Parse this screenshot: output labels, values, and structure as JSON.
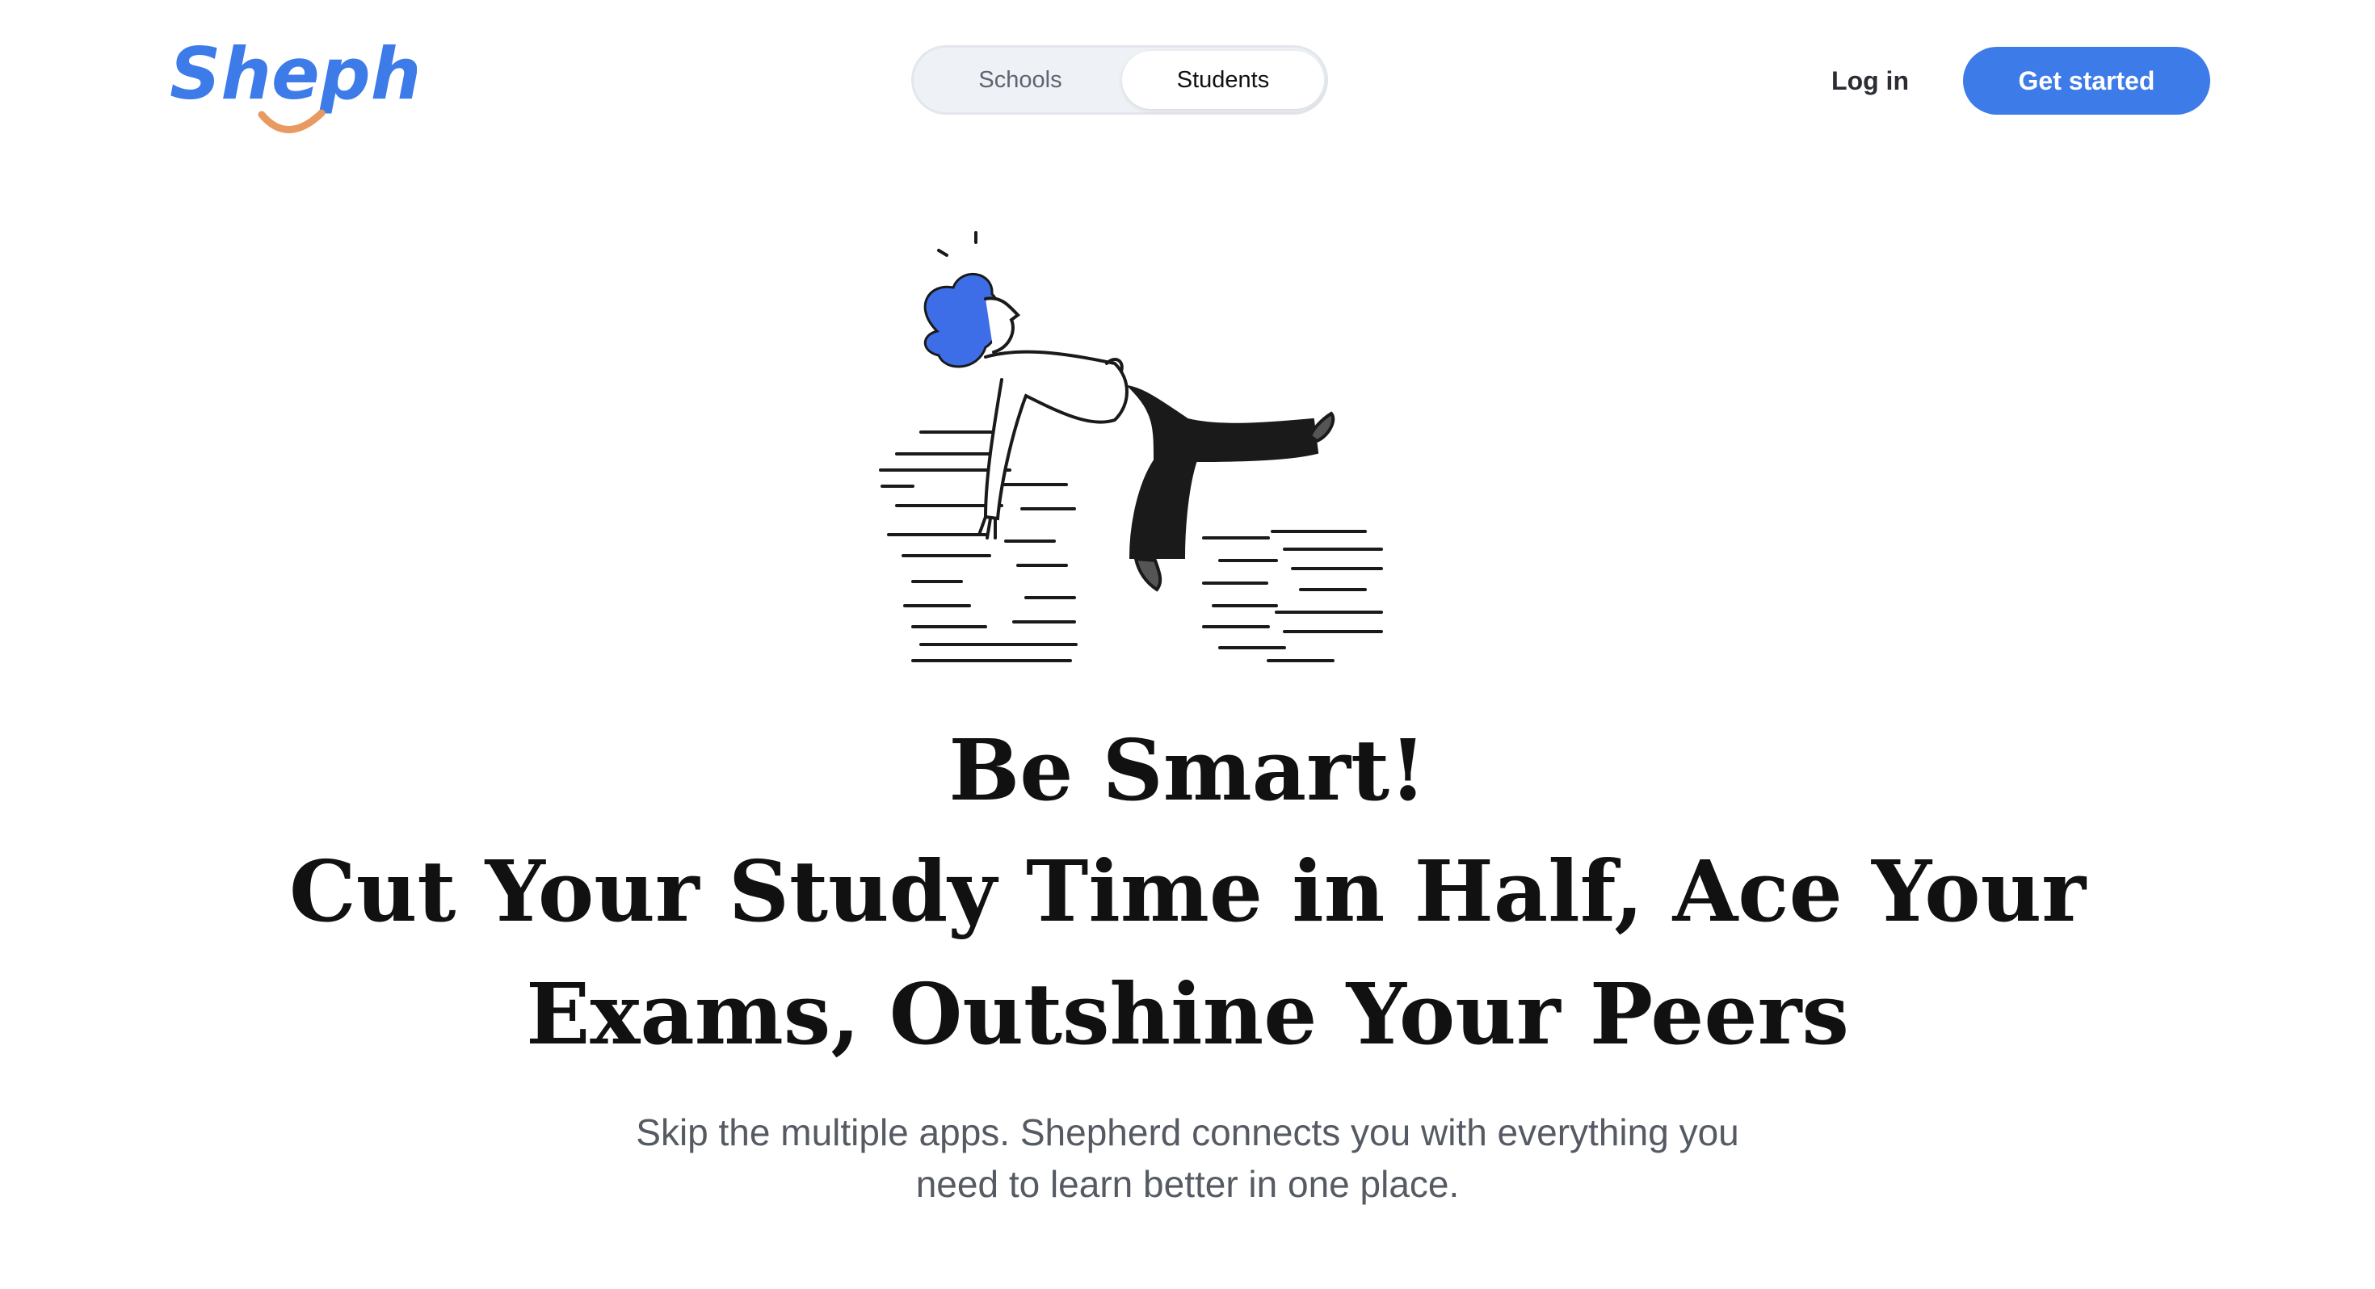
{
  "brand": {
    "name": "Shepherd",
    "color": "#3d7be8",
    "smile_color": "#e89a62"
  },
  "nav": {
    "toggle": {
      "schools_label": "Schools",
      "students_label": "Students",
      "selected": "Students"
    },
    "login_label": "Log in",
    "cta_label": "Get started",
    "cta_color": "#3d7be8"
  },
  "hero": {
    "illustration": "person-resting-on-stack-of-papers",
    "heading_line1": "Be Smart!",
    "heading_line2": "Cut Your Study Time in Half, Ace Your",
    "heading_line3": "Exams, Outshine Your Peers",
    "subtext_line1": "Skip the multiple apps. Shepherd connects you with everything you",
    "subtext_line2": "need to learn better in one place."
  }
}
